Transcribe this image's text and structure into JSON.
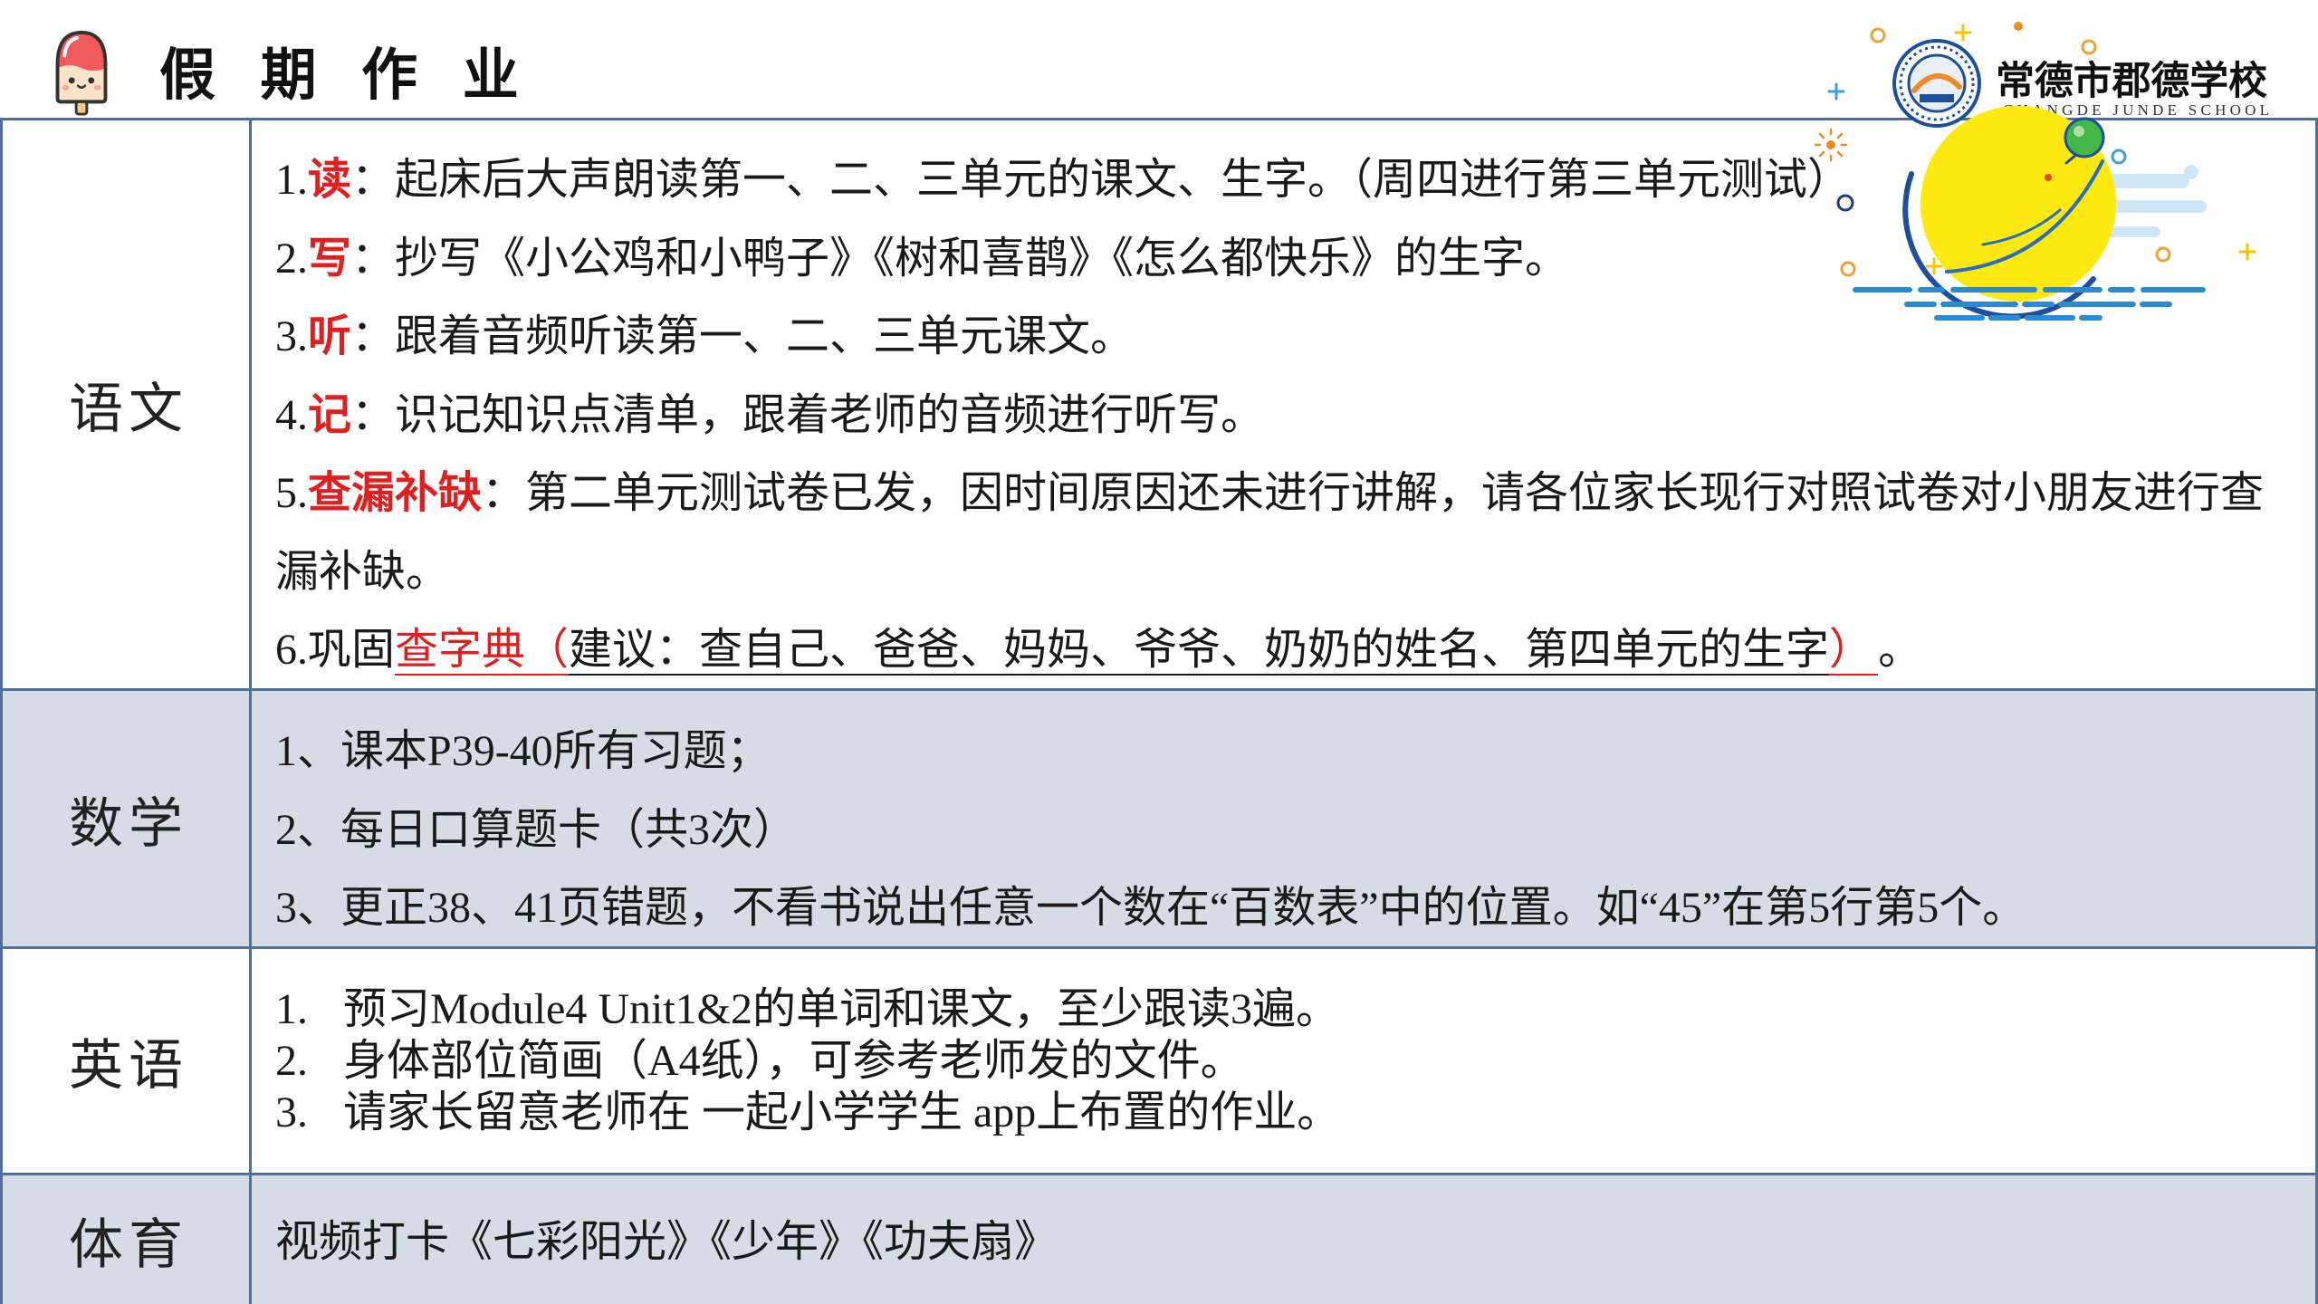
{
  "header": {
    "title": "假 期 作 业",
    "icon": "popsicle-icon"
  },
  "logo": {
    "name": "常德市郡德学校",
    "name_en": "CHANGDE JUNDE SCHOOL",
    "emblem_icon": "school-emblem-icon",
    "decoration": "moon-decoration"
  },
  "colors": {
    "keyword_red": "#e02020",
    "border": "#4f6e98",
    "alt_row_bg": "#d6dce5",
    "text": "#1a1a1a"
  },
  "subjects": {
    "chinese": {
      "label": "语文",
      "items": [
        {
          "num": "1.",
          "key": "读",
          "text": "：起床后大声朗读第一、二、三单元的课文、生字。（周四进行第三单元测试）"
        },
        {
          "num": "2.",
          "key": "写",
          "text": "：抄写《小公鸡和小鸭子》《树和喜鹊》《怎么都快乐》的生字。"
        },
        {
          "num": "3.",
          "key": "听",
          "text": "：跟着音频听读第一、二、三单元课文。"
        },
        {
          "num": "4.",
          "key": "记",
          "text": "：识记知识点清单，跟着老师的音频进行听写。"
        },
        {
          "num": "5.",
          "key": "查漏补缺",
          "text": "：第二单元测试卷已发，因时间原因还未进行讲解，请各位家长现行对照试卷对小朋友进行查漏补缺。"
        },
        {
          "num": "6.",
          "prefix": "巩固",
          "key_open": "查字典（",
          "note": "建议：查自己、爸爸、妈妈、爷爷、奶奶的姓名、第四单元的生字",
          "key_close": "）",
          "end": "。"
        }
      ]
    },
    "math": {
      "label": "数学",
      "items": [
        "1、课本P39-40所有习题；",
        "2、每日口算题卡（共3次）",
        "3、更正38、41页错题，不看书说出任意一个数在“百数表”中的位置。如“45”在第5行第5个。"
      ]
    },
    "english": {
      "label": "英语",
      "items": [
        {
          "num": "1.",
          "text": "预习Module4 Unit1&2的单词和课文，至少跟读3遍。"
        },
        {
          "num": "2.",
          "text": "身体部位简画（A4纸），可参考老师发的文件。"
        },
        {
          "num": "3.",
          "text": "请家长留意老师在 一起小学学生 app上布置的作业。"
        }
      ]
    },
    "pe": {
      "label": "体育",
      "items": [
        "视频打卡《七彩阳光》《少年》《功夫扇》"
      ]
    }
  }
}
